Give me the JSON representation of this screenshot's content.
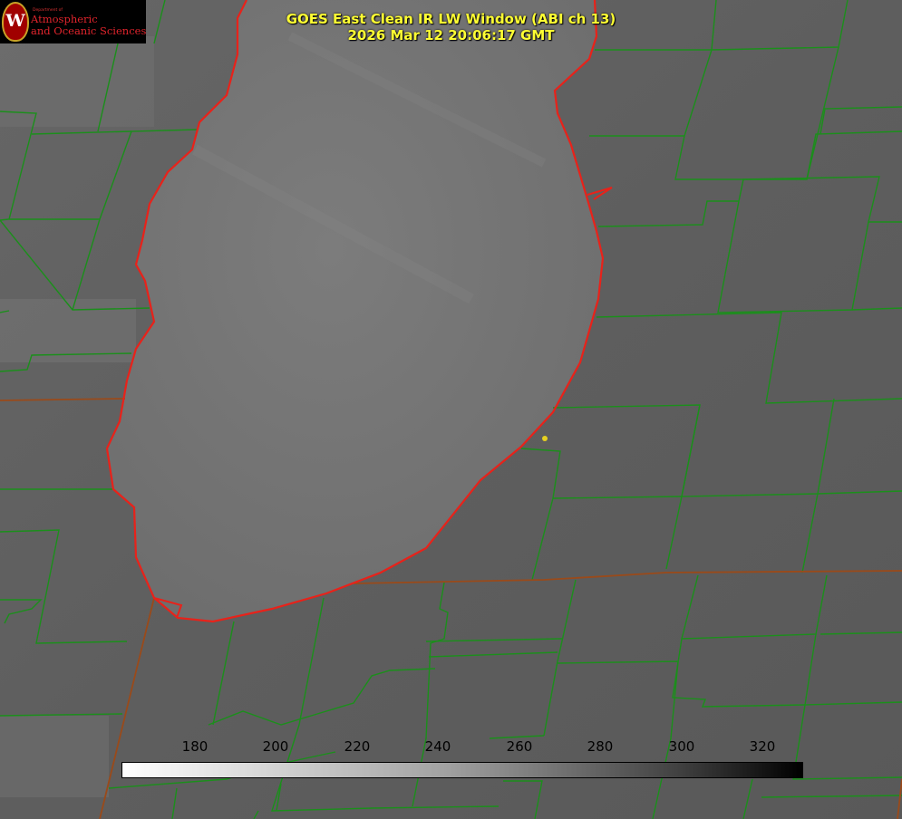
{
  "title": {
    "line1": "GOES East Clean IR LW Window (ABI ch 13)",
    "line2": "2026 Mar 12 20:06:17 GMT"
  },
  "logo": {
    "department": "Department of",
    "line1": "Atmospheric",
    "line2": "and Oceanic Sciences",
    "emblem": "W"
  },
  "colorbar": {
    "ticks": [
      "180",
      "200",
      "220",
      "240",
      "260",
      "280",
      "300",
      "320"
    ],
    "palette": "white-to-black grayscale"
  },
  "colors": {
    "county_lines": "#1b8f1b",
    "state_lines": "#9a4a1a",
    "lake_coastline": "#e8221a",
    "title_text": "#ffff33",
    "station_marker": "#e6d020"
  },
  "map": {
    "features": [
      "lake-michigan",
      "county-boundaries",
      "state-boundaries",
      "coastline",
      "station-marker"
    ]
  }
}
